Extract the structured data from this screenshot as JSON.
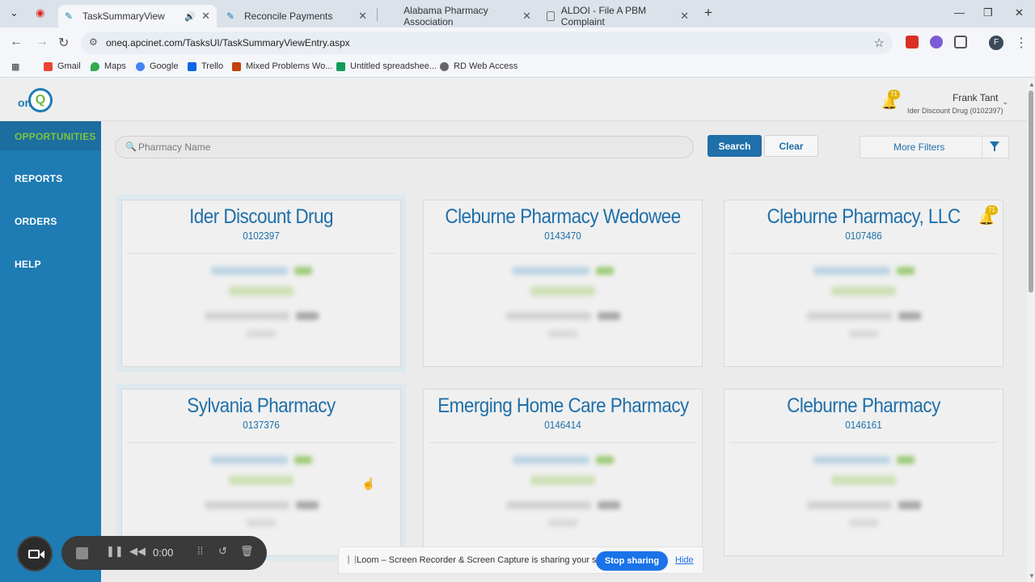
{
  "browser": {
    "tabs": [
      {
        "title": "TaskSummaryView",
        "active": true
      },
      {
        "title": "Reconcile Payments",
        "active": false
      },
      {
        "title": "Alabama Pharmacy Association",
        "active": false
      },
      {
        "title": "ALDOI - File A PBM Complaint",
        "active": false
      }
    ],
    "new_tab": "+",
    "url": "oneq.apcinet.com/TasksUI/TaskSummaryViewEntry.aspx",
    "profile_initial": "F",
    "bookmarks": [
      "Gmail",
      "Maps",
      "Google",
      "Trello",
      "Mixed Problems Wo...",
      "Untitled spreadshee...",
      "RD Web Access"
    ]
  },
  "header": {
    "logo_text": "one",
    "logo_q": "Q",
    "notification_count": "71",
    "user_name": "Frank Tant",
    "user_store": "Ider Discount Drug (0102397)"
  },
  "sidebar": {
    "items": [
      {
        "label": "OPPORTUNITIES",
        "active": true
      },
      {
        "label": "REPORTS",
        "active": false
      },
      {
        "label": "ORDERS",
        "active": false
      },
      {
        "label": "HELP",
        "active": false
      }
    ]
  },
  "search": {
    "placeholder": "Pharmacy Name",
    "search_label": "Search",
    "clear_label": "Clear",
    "more_filters_label": "More Filters"
  },
  "cards": [
    {
      "name": "Ider Discount Drug",
      "number": "0102397"
    },
    {
      "name": "Cleburne Pharmacy Wedowee",
      "number": "0143470"
    },
    {
      "name": "Cleburne Pharmacy, LLC",
      "number": "0107486",
      "notification_count": "71"
    },
    {
      "name": "Sylvania Pharmacy",
      "number": "0137376"
    },
    {
      "name": "Emerging Home Care Pharmacy",
      "number": "0146414"
    },
    {
      "name": "Cleburne Pharmacy",
      "number": "0146161"
    }
  ],
  "loom": {
    "time": "0:00",
    "share_message": "Loom – Screen Recorder & Screen Capture is sharing your screen.",
    "stop_label": "Stop sharing",
    "hide_label": "Hide"
  },
  "colors": {
    "brand_blue": "#1f6fa9",
    "sidebar_blue": "#1e7bb3",
    "active_green": "#7ec342",
    "badge_yellow": "#e2b400"
  }
}
